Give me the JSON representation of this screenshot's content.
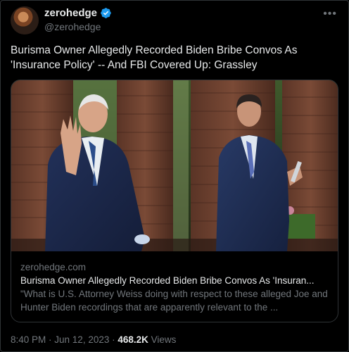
{
  "author": {
    "display_name": "zerohedge",
    "handle": "@zerohedge",
    "verified": true
  },
  "menu_icon": "more-horizontal-icon",
  "tweet": {
    "text": "Burisma Owner Allegedly Recorded Biden Bribe Convos As 'Insurance Policy' -- And FBI Covered Up: Grassley"
  },
  "link_card": {
    "domain": "zerohedge.com",
    "title": "Burisma Owner Allegedly Recorded Biden Bribe Convos As 'Insuran...",
    "description": "\"What is U.S. Attorney Weiss doing with respect to these alleged Joe and Hunter Biden recordings that are apparently relevant to the ..."
  },
  "footer": {
    "time": "8:40 PM",
    "separator": " · ",
    "date": "Jun 12, 2023",
    "views_count": "468.2K",
    "views_label": " Views"
  },
  "colors": {
    "background": "#000000",
    "text_primary": "#e7e9ea",
    "text_secondary": "#71767b",
    "border": "#2f3336",
    "verified_blue": "#1d9bf0"
  }
}
